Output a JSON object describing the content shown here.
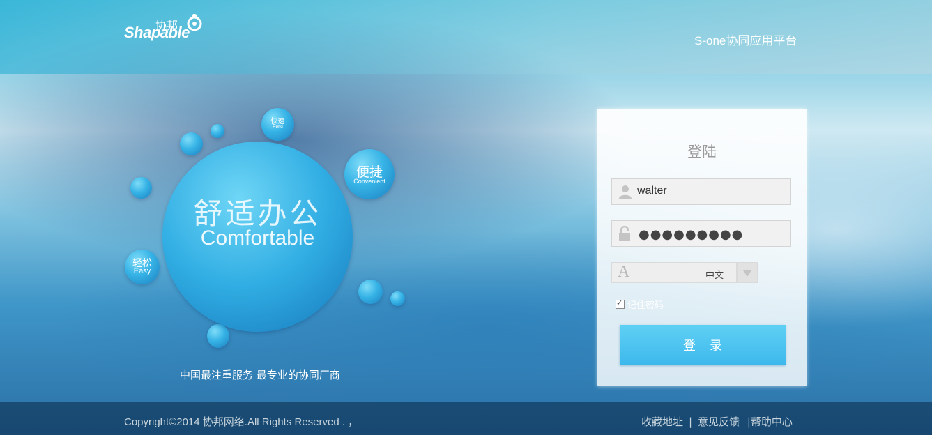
{
  "header": {
    "logo_cn": "协邦",
    "logo_en": "Shapable",
    "platform_title": "S-one协同应用平台"
  },
  "hero": {
    "main_cn": "舒适办公",
    "main_en": "Comfortable",
    "fast_cn": "快速",
    "fast_en": "Fast",
    "convenient_cn": "便捷",
    "convenient_en": "Convenient",
    "easy_cn": "轻松",
    "easy_en": "Easy",
    "slogan": "中国最注重服务  最专业的协同厂商"
  },
  "login": {
    "title": "登陆",
    "username_value": "walter",
    "password_mask": "●●●●●●●●●",
    "language_value": "中文",
    "remember_label": "记住密码",
    "submit_label": "登录"
  },
  "footer": {
    "copyright": "Copyright©2014 协邦网络.All Rights Reserved . ，",
    "link_bookmark": "收藏地址",
    "link_feedback": "意见反馈",
    "link_help": "|帮助中心",
    "separator": "|"
  }
}
